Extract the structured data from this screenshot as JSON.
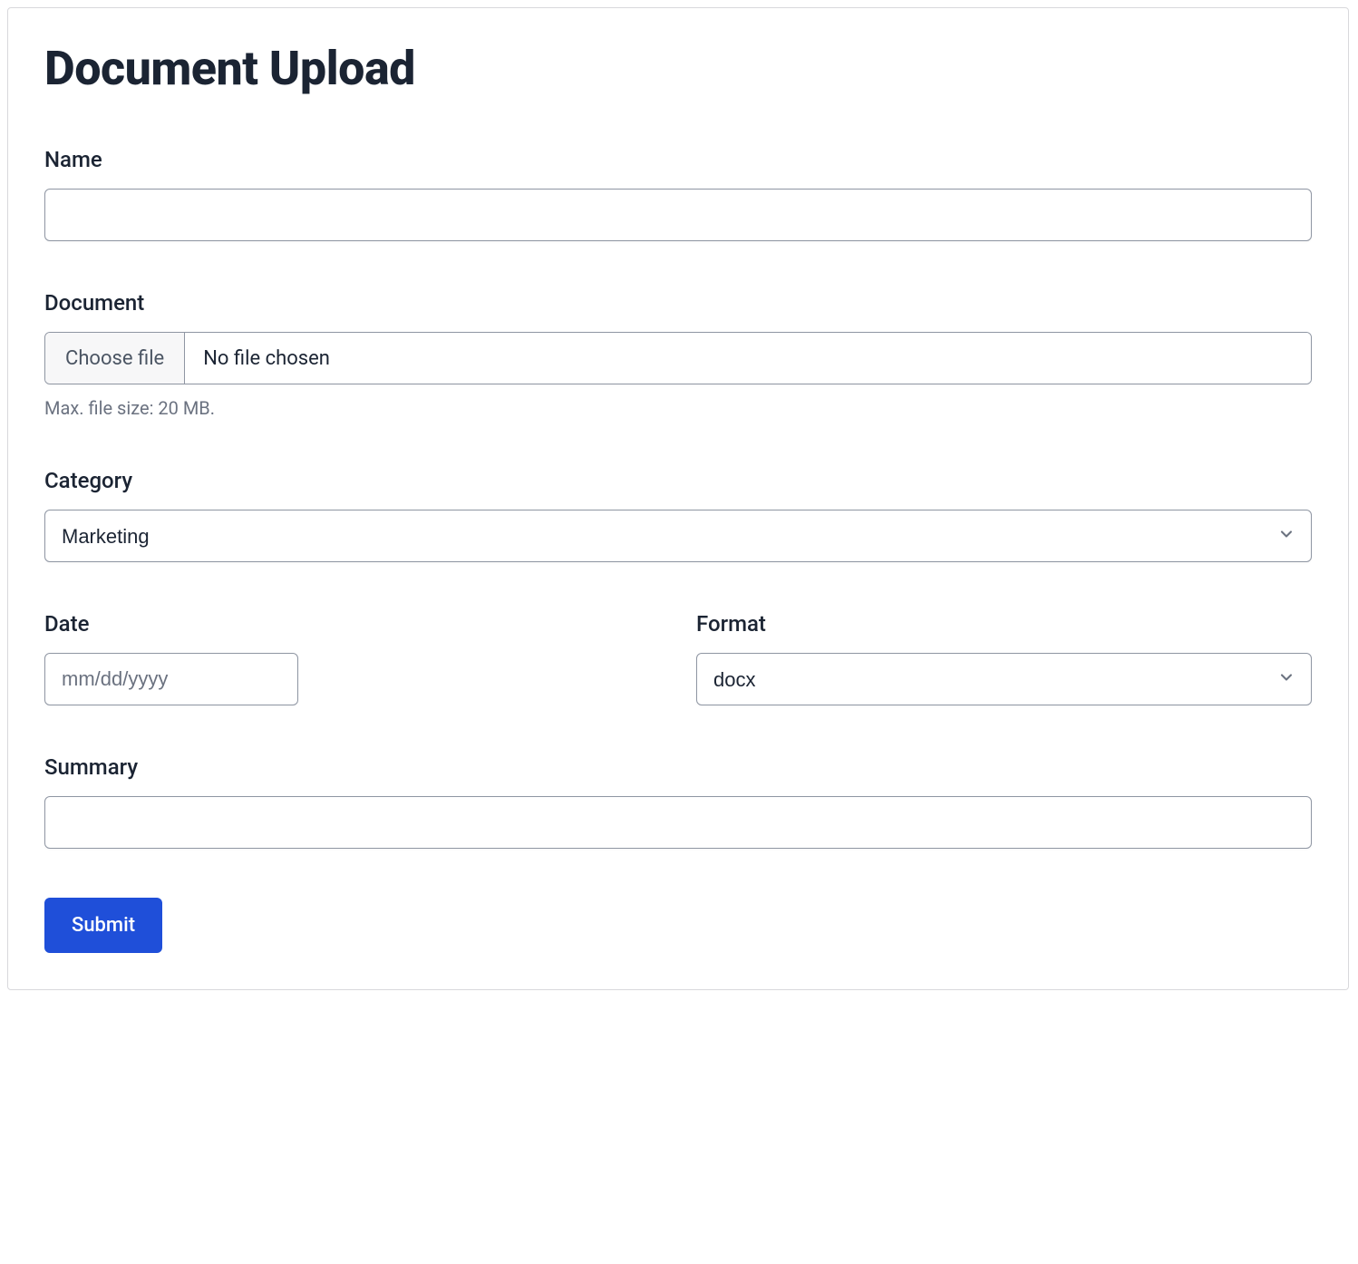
{
  "title": "Document Upload",
  "fields": {
    "name": {
      "label": "Name",
      "value": ""
    },
    "document": {
      "label": "Document",
      "choose_button": "Choose file",
      "status": "No file chosen",
      "hint": "Max. file size: 20 MB."
    },
    "category": {
      "label": "Category",
      "value": "Marketing"
    },
    "date": {
      "label": "Date",
      "placeholder": "mm/dd/yyyy",
      "value": ""
    },
    "format": {
      "label": "Format",
      "value": "docx"
    },
    "summary": {
      "label": "Summary",
      "value": ""
    }
  },
  "submit_label": "Submit"
}
